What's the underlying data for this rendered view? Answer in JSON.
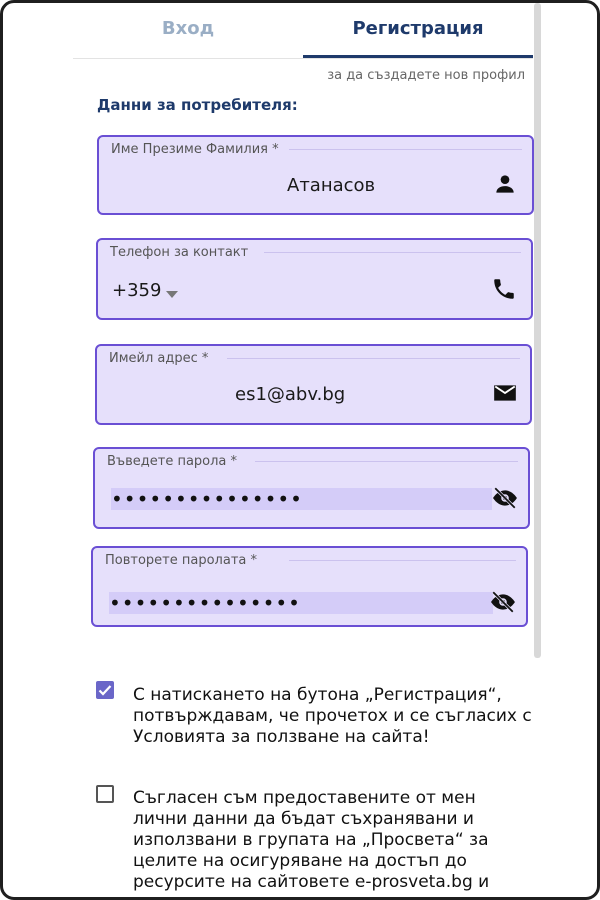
{
  "tabs": [
    {
      "label": "Вход",
      "active": false
    },
    {
      "label": "Регистрация",
      "active": true
    }
  ],
  "subtitle": "за да създадете нов профил",
  "section_title": "Данни за потребителя:",
  "fields": {
    "name": {
      "label": "Име Презиме Фамилия *",
      "value": "Атанасов",
      "icon": "person-icon"
    },
    "phone": {
      "label": "Телефон за контакт",
      "value": "+359",
      "icon": "phone-icon"
    },
    "email": {
      "label": "Имейл адрес *",
      "value": "es1@abv.bg",
      "icon": "mail-icon"
    },
    "password": {
      "label": "Въведете парола *",
      "value": "•••••••••••••••",
      "icon": "visibility-off-icon"
    },
    "password_repeat": {
      "label": "Повторете паролата *",
      "value": "•••••••••••••••",
      "icon": "visibility-off-icon"
    }
  },
  "checkboxes": [
    {
      "checked": true,
      "text": "С натискането на бутона „Регистрация“, потвърждавам, че прочетох и се съгласих с Условията за ползване на сайта!"
    },
    {
      "checked": false,
      "text": "Съгласен съм предоставените от мен лични данни да бъдат съхранявани и използвани в групата на „Просвета“ за целите на осигуряване на достъп до ресурсите на сайтовете e-prosveta.bg и"
    }
  ],
  "colors": {
    "accent": "#6a4fd4",
    "field_bg": "#e6e0fb",
    "primary": "#1e3a6b"
  }
}
